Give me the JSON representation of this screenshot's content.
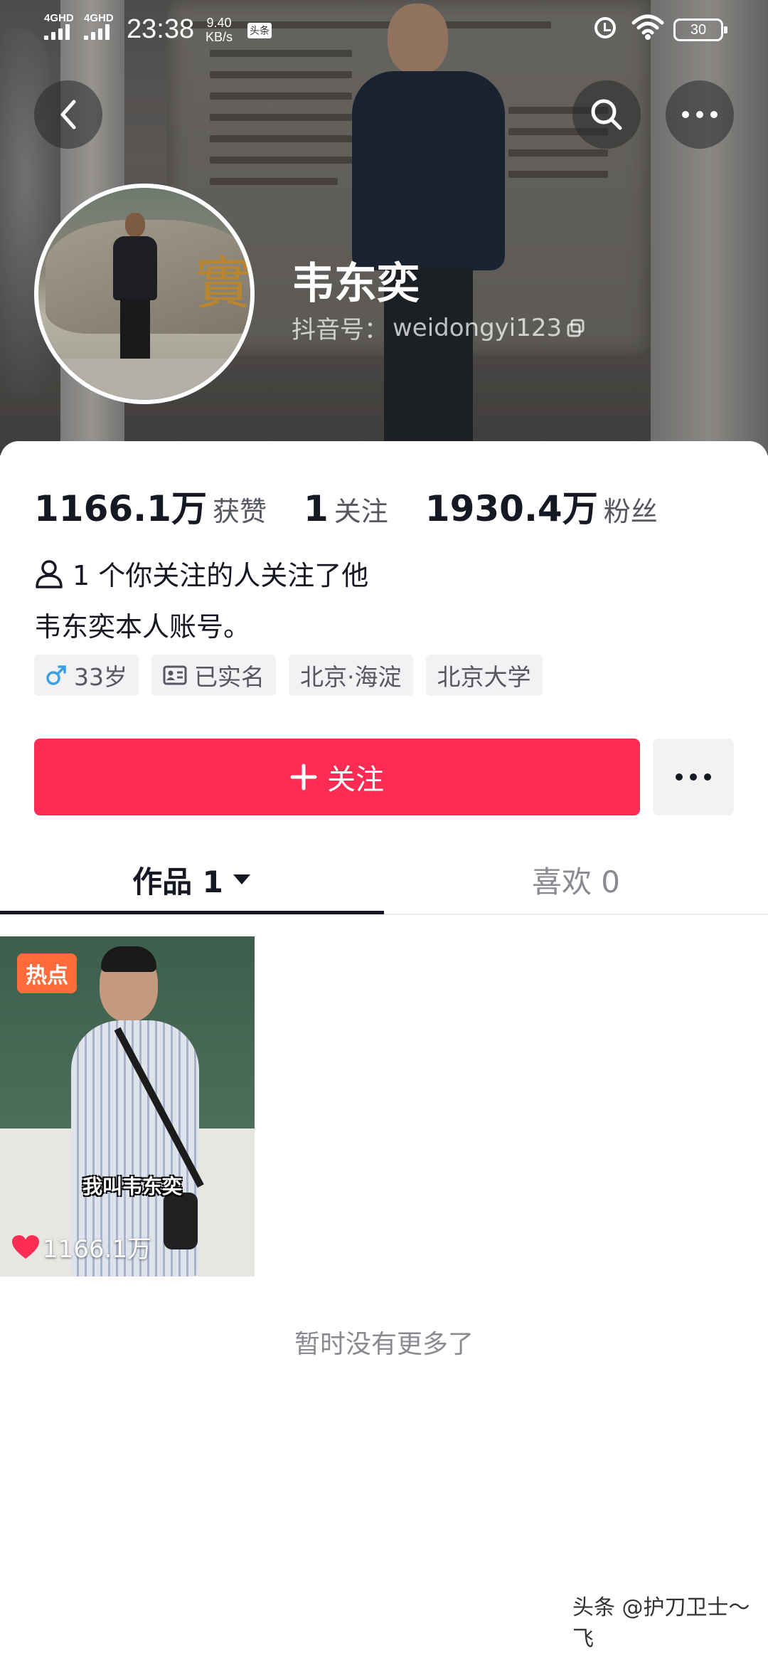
{
  "status_bar": {
    "sim1": "4GHD",
    "sim2": "4GHD",
    "time": "23:38",
    "net_speed_value": "9.40",
    "net_speed_unit": "KB/s",
    "app_badge": "头条",
    "battery": "30"
  },
  "profile": {
    "name": "韦东奕",
    "douyin_id_label": "抖音号：",
    "douyin_id": "weidongyi123"
  },
  "stats": [
    {
      "value": "1166.1万",
      "label": "获赞"
    },
    {
      "value": "1",
      "label": "关注"
    },
    {
      "value": "1930.4万",
      "label": "粉丝"
    }
  ],
  "mutual_follow": "1 个你关注的人关注了他",
  "bio": "韦东奕本人账号。",
  "tags": {
    "gender_age": "33岁",
    "verified": "已实名",
    "location": "北京·海淀",
    "school": "北京大学"
  },
  "follow_button": "关注",
  "tabs": {
    "works": "作品 1",
    "likes": "喜欢 0"
  },
  "video": {
    "hot_badge": "热点",
    "caption": "我叫韦东奕",
    "likes": "1166.1万"
  },
  "no_more_text": "暂时没有更多了",
  "watermark": "头条 @护刀卫士～飞",
  "colors": {
    "accent": "#fe2c55",
    "hot_badge": "#ff6b3a",
    "like_heart": "#fe2c55",
    "gender_icon": "#3aa0e6"
  }
}
